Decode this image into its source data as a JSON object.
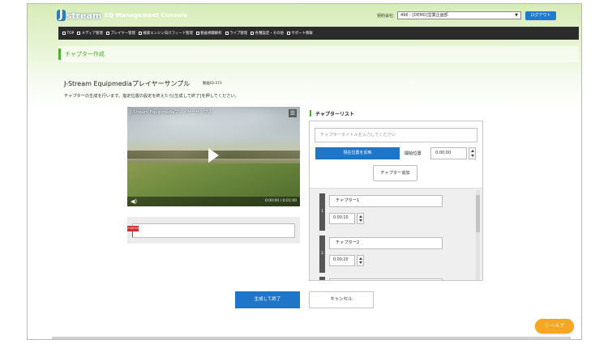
{
  "header": {
    "logo_mark": "J",
    "logo_text": "stream",
    "console_title": "EQ Management Console",
    "account_label": "契約会社:",
    "account_value": "496 : [DEMO]営業企画部",
    "logout_label": "ログアウト"
  },
  "nav": {
    "items": [
      {
        "label": "TOP"
      },
      {
        "label": "メディア管理"
      },
      {
        "label": "プレイヤー管理"
      },
      {
        "label": "検索エンジン向けフィード管理"
      },
      {
        "label": "動画視聴解析"
      },
      {
        "label": "ライブ管理"
      },
      {
        "label": "各種設定・その他"
      },
      {
        "label": "サポート情報"
      }
    ]
  },
  "section_title": "チャプター作成",
  "page": {
    "title": "J-Stream Equipmediaプレイヤーサンプル",
    "id_label": "動画ID:371",
    "instruction": "チャプターの生成を行います。指定位置の設定を終えたら[生成して終了]を押してください。"
  },
  "video": {
    "title": "J-Stream Equipmediaプレイヤーサンプル",
    "menu_icon": "list-icon",
    "time": "0:00:00 / 0:01:00",
    "volume_icon": "speaker-icon"
  },
  "timeline": {
    "marker_label": "0:00:00"
  },
  "chapter_list": {
    "title": "チャプターリスト",
    "title_placeholder": "チャプタータイトルを入力してください",
    "reflect_label": "現在位置を反映",
    "start_label": "開始位置",
    "start_value": "0:00:00",
    "add_label": "チャプター追加",
    "items": [
      {
        "num": "1",
        "name": "チャプター1",
        "time": "0:00:10"
      },
      {
        "num": "2",
        "name": "チャプター2",
        "time": "0:00:20"
      },
      {
        "num": "3",
        "name": "",
        "time": ""
      }
    ]
  },
  "buttons": {
    "submit_label": "生成して終了",
    "cancel_label": "キャンセル",
    "help_label": "ヘルプ"
  },
  "colors": {
    "accent_green": "#4caf2a",
    "primary_blue": "#1f76c8",
    "help_orange": "#f5a623"
  }
}
